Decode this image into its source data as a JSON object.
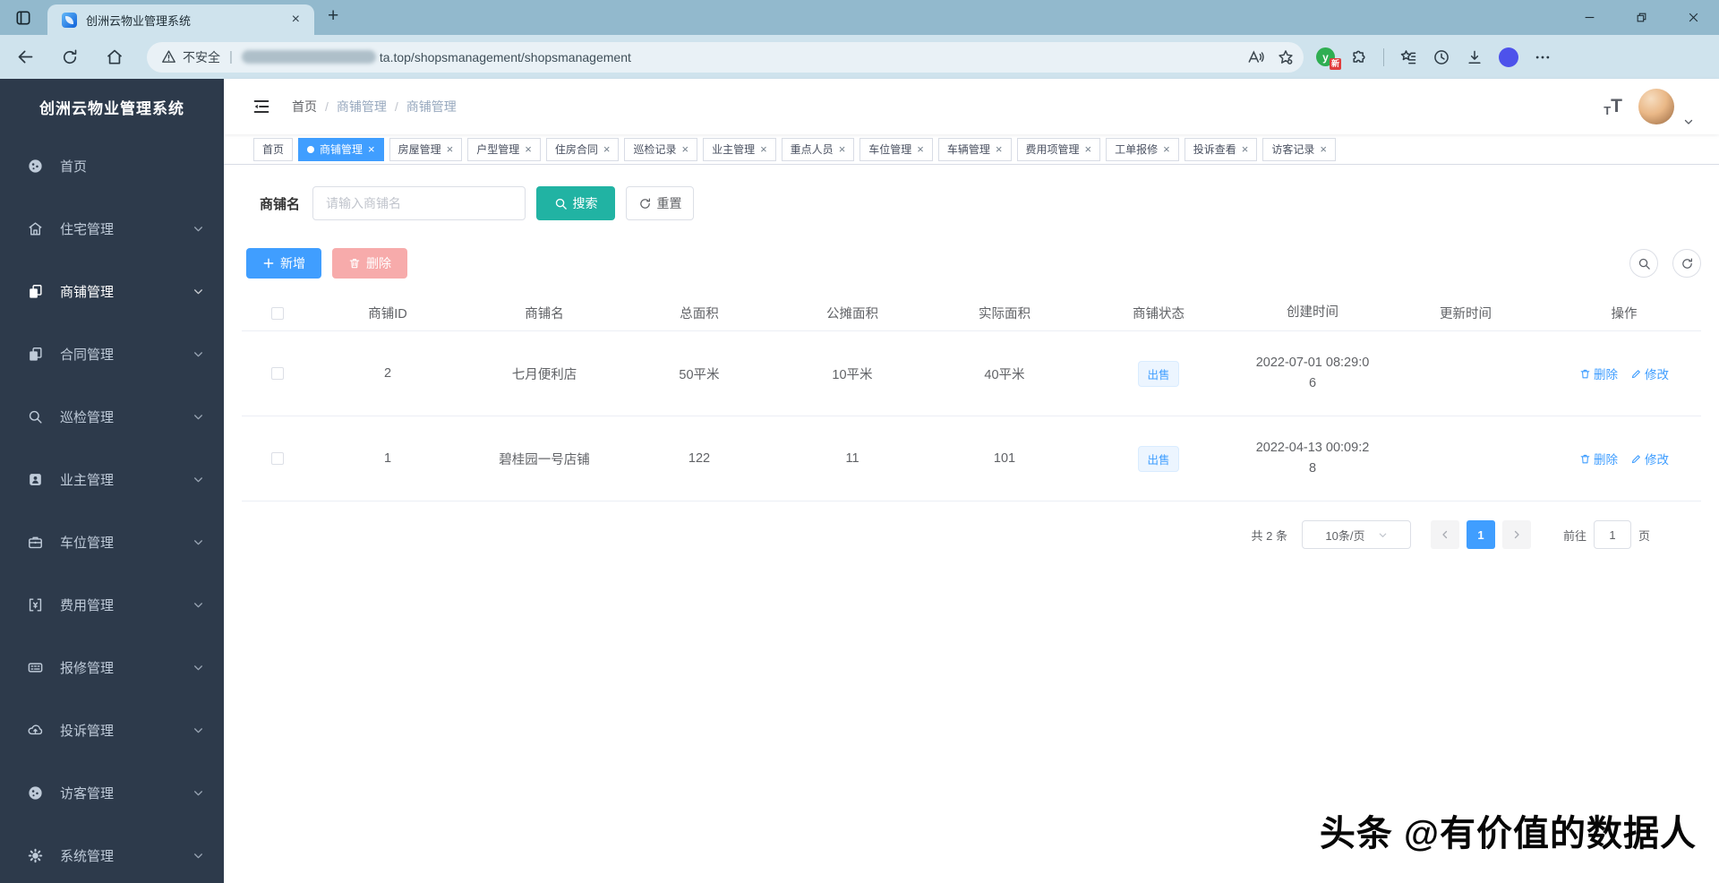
{
  "browser": {
    "tab_title": "创洲云物业管理系统",
    "security_label": "不安全",
    "url": "ta.top/shopsmanagement/shopsmanagement",
    "extension_letter": "y",
    "extension_badge": "新"
  },
  "app": {
    "sidebar": {
      "title": "创洲云物业管理系统",
      "items": [
        {
          "label": "首页",
          "icon": "dashboard-icon"
        },
        {
          "label": "住宅管理",
          "icon": "residence-icon"
        },
        {
          "label": "商铺管理",
          "icon": "shop-icon"
        },
        {
          "label": "合同管理",
          "icon": "contract-icon"
        },
        {
          "label": "巡检管理",
          "icon": "patrol-icon"
        },
        {
          "label": "业主管理",
          "icon": "owner-icon"
        },
        {
          "label": "车位管理",
          "icon": "parking-icon"
        },
        {
          "label": "费用管理",
          "icon": "fee-icon"
        },
        {
          "label": "报修管理",
          "icon": "repair-icon"
        },
        {
          "label": "投诉管理",
          "icon": "complaint-icon"
        },
        {
          "label": "访客管理",
          "icon": "visitor-icon"
        },
        {
          "label": "系统管理",
          "icon": "system-icon"
        }
      ]
    },
    "breadcrumb": {
      "separator": "/",
      "items": [
        "首页",
        "商铺管理",
        "商铺管理"
      ]
    },
    "tags": [
      {
        "label": "首页",
        "active": false,
        "closable": false
      },
      {
        "label": "商铺管理",
        "active": true,
        "closable": true
      },
      {
        "label": "房屋管理",
        "active": false,
        "closable": true
      },
      {
        "label": "户型管理",
        "active": false,
        "closable": true
      },
      {
        "label": "住房合同",
        "active": false,
        "closable": true
      },
      {
        "label": "巡检记录",
        "active": false,
        "closable": true
      },
      {
        "label": "业主管理",
        "active": false,
        "closable": true
      },
      {
        "label": "重点人员",
        "active": false,
        "closable": true
      },
      {
        "label": "车位管理",
        "active": false,
        "closable": true
      },
      {
        "label": "车辆管理",
        "active": false,
        "closable": true
      },
      {
        "label": "费用项管理",
        "active": false,
        "closable": true
      },
      {
        "label": "工单报修",
        "active": false,
        "closable": true
      },
      {
        "label": "投诉查看",
        "active": false,
        "closable": true
      },
      {
        "label": "访客记录",
        "active": false,
        "closable": true
      }
    ],
    "search": {
      "label": "商铺名",
      "placeholder": "请输入商铺名",
      "search_button": "搜索",
      "reset_button": "重置"
    },
    "toolbar": {
      "add_button": "新增",
      "delete_button": "删除"
    },
    "table": {
      "headers": [
        "商铺ID",
        "商铺名",
        "总面积",
        "公摊面积",
        "实际面积",
        "商铺状态",
        "创建时间",
        "更新时间",
        "操作"
      ],
      "rows": [
        {
          "id": "2",
          "name": "七月便利店",
          "total_area": "50平米",
          "shared_area": "10平米",
          "actual_area": "40平米",
          "status": "出售",
          "created_at": "2022-07-01 08:29:06",
          "updated_at": ""
        },
        {
          "id": "1",
          "name": "碧桂园一号店铺",
          "total_area": "122",
          "shared_area": "11",
          "actual_area": "101",
          "status": "出售",
          "created_at": "2022-04-13 00:09:28",
          "updated_at": ""
        }
      ],
      "row_actions": {
        "delete": "删除",
        "edit": "修改"
      }
    },
    "pagination": {
      "total": "共 2 条",
      "page_size": "10条/页",
      "current_page": "1",
      "goto_label": "前往",
      "goto_value": "1",
      "page_unit": "页"
    },
    "watermark": "头条 @有价值的数据人"
  },
  "icons_text": {
    "close": "×",
    "plus": "+",
    "dot": "●",
    "divider": "|"
  },
  "colors": {
    "primary": "#409eff",
    "search_button": "#21b3a3",
    "delete_disabled": "#f7abab",
    "sidebar_bg": "#2d3a4b",
    "sidebar_text": "#bfcbd9",
    "status_tag_bg": "#ecf5ff",
    "status_tag_text": "#409eff",
    "browser_titlebar": "#92b9cd",
    "browser_toolbar": "#cfe3ed"
  }
}
